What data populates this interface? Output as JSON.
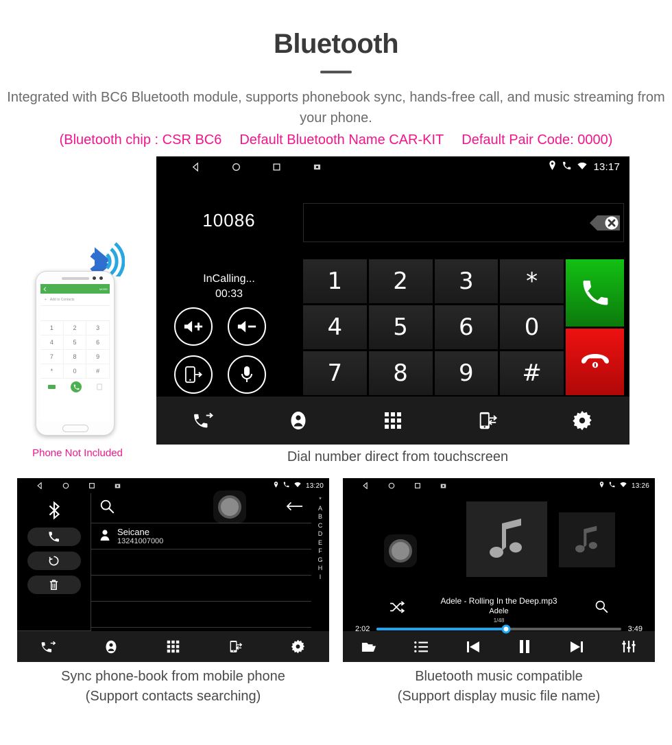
{
  "header": {
    "title": "Bluetooth",
    "subtitle": "Integrated with BC6 Bluetooth module, supports phonebook sync, hands-free call, and music streaming from your phone.",
    "spec_chip": "(Bluetooth chip : CSR BC6",
    "spec_name": "Default Bluetooth Name CAR-KIT",
    "spec_pair": "Default Pair Code: 0000)",
    "accent_color": "#f2158c",
    "text_color": "#6b6b6b"
  },
  "phone_mock": {
    "app_more": "MORE",
    "add_contacts": "Add to Contacts",
    "keys": [
      "1",
      "2",
      "3",
      "4",
      "5",
      "6",
      "7",
      "8",
      "9",
      "*",
      "0",
      "#"
    ],
    "note": "Phone Not Included"
  },
  "main_screen": {
    "statusbar": {
      "left_icons": [
        "back-icon",
        "home-icon",
        "recents-icon",
        "screenshot-icon"
      ],
      "right_icons": [
        "location-icon",
        "phone-icon",
        "wifi-icon"
      ],
      "time": "13:17"
    },
    "dialed_number": "10086",
    "call_state": "InCalling...",
    "call_timer": "00:33",
    "call_controls": [
      "volume-up-icon",
      "volume-down-icon",
      "transfer-audio-icon",
      "mute-mic-icon"
    ],
    "input_value": "",
    "delete_key": "backspace-clear-icon",
    "keypad": [
      "1",
      "2",
      "3",
      "*",
      "4",
      "5",
      "6",
      "0",
      "7",
      "8",
      "9",
      "#"
    ],
    "call_button": "call-icon",
    "hangup_button": "hangup-icon",
    "call_color": "#13c013",
    "hangup_color": "#ee1111",
    "tabs": [
      "call-history-icon",
      "contacts-icon",
      "keypad-icon",
      "phone-sync-icon",
      "settings-icon"
    ],
    "caption": "Dial number direct from touchscreen"
  },
  "phonebook_screen": {
    "statusbar": {
      "left_icons": [
        "back-icon",
        "home-icon",
        "recents-icon",
        "screenshot-icon"
      ],
      "right_icons": [
        "location-icon",
        "phone-icon",
        "wifi-icon"
      ],
      "time": "13:20"
    },
    "side_tools": [
      "bluetooth-icon",
      "call-icon",
      "sync-icon",
      "delete-icon"
    ],
    "search_icon": "search-icon",
    "back_icon": "back-arrow-icon",
    "contact": {
      "name": "Seicane",
      "number": "13241007000"
    },
    "index_letters": [
      "*",
      "A",
      "B",
      "C",
      "D",
      "E",
      "F",
      "G",
      "H",
      "I"
    ],
    "tabs": [
      "call-history-icon",
      "contacts-icon",
      "keypad-icon",
      "phone-sync-icon",
      "settings-icon"
    ],
    "caption_line1": "Sync phone-book from mobile phone",
    "caption_line2": "(Support contacts searching)"
  },
  "music_screen": {
    "statusbar": {
      "left_icons": [
        "back-icon",
        "home-icon",
        "recents-icon",
        "screenshot-icon"
      ],
      "right_icons": [
        "location-icon",
        "phone-icon",
        "wifi-icon"
      ],
      "time": "13:26"
    },
    "album_art": "music-note-icon",
    "track_title": "Adele - Rolling In the Deep.mp3",
    "artist": "Adele",
    "track_position": "1/48",
    "elapsed": "2:02",
    "duration": "3:49",
    "progress_percent": 53,
    "shuffle_icon": "shuffle-icon",
    "search_icon": "search-icon",
    "seek_color": "#1ea7f0",
    "controls": [
      "folder-icon",
      "playlist-icon",
      "previous-icon",
      "pause-icon",
      "next-icon",
      "equalizer-icon"
    ],
    "caption_line1": "Bluetooth music compatible",
    "caption_line2": "(Support display music file name)"
  }
}
